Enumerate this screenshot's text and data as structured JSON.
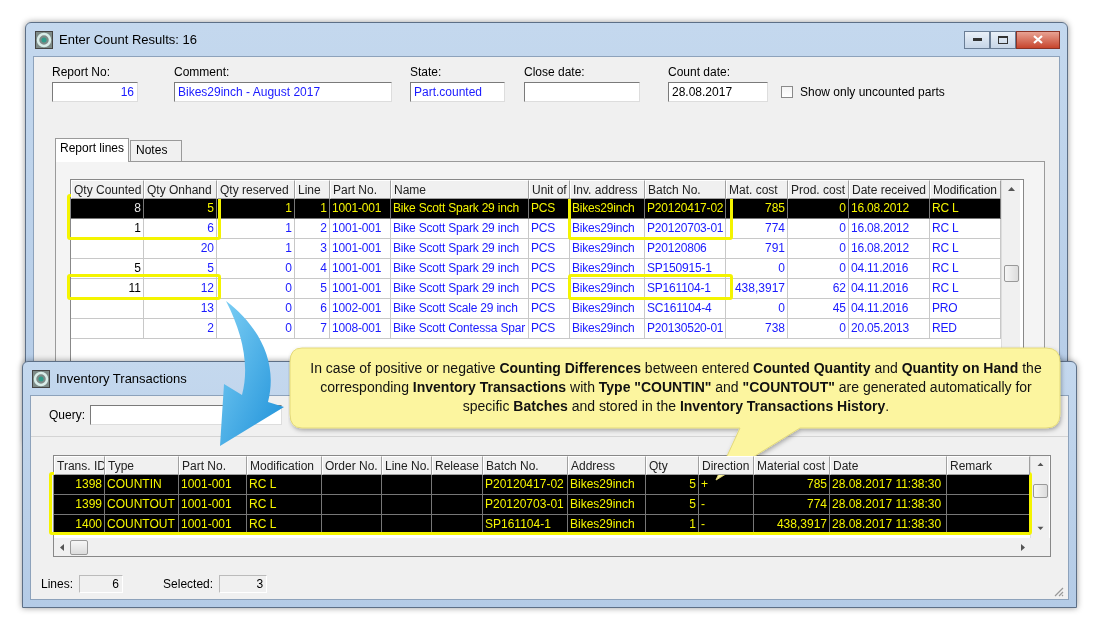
{
  "count_window": {
    "title": "Enter Count Results: 16",
    "fields": [
      {
        "label": "Report No:",
        "value": "16",
        "kind": "number"
      },
      {
        "label": "Comment:",
        "value": "Bikes29inch - August 2017",
        "kind": "text"
      },
      {
        "label": "State:",
        "value": "Part.counted",
        "kind": "text"
      },
      {
        "label": "Close date:",
        "kind": "date"
      },
      {
        "label": "Count date:",
        "value": "28.08.2017",
        "kind": "date"
      }
    ],
    "checkbox": {
      "label": "Show only uncounted parts",
      "checked": false
    },
    "tabs": [
      {
        "label": "Report lines",
        "selected": true
      },
      {
        "label": "Notes",
        "selected": false
      }
    ],
    "grid": {
      "columns": [
        {
          "label": "Qty Counted",
          "kind": "input"
        },
        {
          "label": "Qty Onhand",
          "kind": "number"
        },
        {
          "label": "Qty reserved",
          "kind": "number"
        },
        {
          "label": "Line",
          "kind": "number"
        },
        {
          "label": "Part No.",
          "kind": "text"
        },
        {
          "label": "Name",
          "kind": "text"
        },
        {
          "label": "Unit of",
          "kind": "text"
        },
        {
          "label": "Inv. address",
          "kind": "text"
        },
        {
          "label": "Batch No.",
          "kind": "text"
        },
        {
          "label": "Mat. cost",
          "kind": "number"
        },
        {
          "label": "Prod. cost",
          "kind": "number"
        },
        {
          "label": "Date received",
          "kind": "text"
        },
        {
          "label": "Modification",
          "kind": "text"
        }
      ],
      "rows": [
        {
          "selected": true,
          "cells": [
            "8",
            "5",
            "1",
            "1",
            "1001-001",
            "Bike Scott Spark 29 inch",
            "PCS",
            "Bikes29inch",
            "P20120417-02",
            "785",
            "0",
            "16.08.2012",
            "RC L"
          ]
        },
        {
          "selected": false,
          "cells": [
            "1",
            "6",
            "1",
            "2",
            "1001-001",
            "Bike Scott Spark 29 inch",
            "PCS",
            "Bikes29inch",
            "P20120703-01",
            "774",
            "0",
            "16.08.2012",
            "RC L"
          ]
        },
        {
          "selected": false,
          "cells": [
            null,
            "20",
            "1",
            "3",
            "1001-001",
            "Bike Scott Spark 29 inch",
            "PCS",
            "Bikes29inch",
            "P20120806",
            "791",
            "0",
            "16.08.2012",
            "RC L"
          ]
        },
        {
          "selected": false,
          "cells": [
            "5",
            "5",
            "0",
            "4",
            "1001-001",
            "Bike Scott Spark 29 inch",
            "PCS",
            "Bikes29inch",
            "SP150915-1",
            "0",
            "0",
            "04.11.2016",
            "RC L"
          ]
        },
        {
          "selected": false,
          "cells": [
            "11",
            "12",
            "0",
            "5",
            "1001-001",
            "Bike Scott Spark 29 inch",
            "PCS",
            "Bikes29inch",
            "SP161104-1",
            "438,3917",
            "62",
            "04.11.2016",
            "RC L"
          ]
        },
        {
          "selected": false,
          "cells": [
            null,
            "13",
            "0",
            "6",
            "1002-001",
            "Bike Scott Scale 29 inch",
            "PCS",
            "Bikes29inch",
            "SC161104-4",
            "0",
            "45",
            "04.11.2016",
            "PRO"
          ]
        },
        {
          "selected": false,
          "cells": [
            null,
            "2",
            "0",
            "7",
            "1008-001",
            "Bike Scott Contessa Spar",
            "PCS",
            "Bikes29inch",
            "P20130520-01",
            "738",
            "0",
            "20.05.2013",
            "RED"
          ]
        }
      ]
    }
  },
  "transactions_window": {
    "title": "Inventory Transactions",
    "query": {
      "label": "Query:"
    },
    "grid": {
      "columns": [
        {
          "label": "Trans. ID",
          "kind": "number"
        },
        {
          "label": "Type",
          "kind": "text"
        },
        {
          "label": "Part No.",
          "kind": "text"
        },
        {
          "label": "Modification",
          "kind": "text"
        },
        {
          "label": "Order No.",
          "kind": "text"
        },
        {
          "label": "Line No.",
          "kind": "text"
        },
        {
          "label": "Release",
          "kind": "text"
        },
        {
          "label": "Batch No.",
          "kind": "text"
        },
        {
          "label": "Address",
          "kind": "text"
        },
        {
          "label": "Qty",
          "kind": "number"
        },
        {
          "label": "Direction",
          "kind": "text"
        },
        {
          "label": "Material cost",
          "kind": "number"
        },
        {
          "label": "Date",
          "kind": "text"
        },
        {
          "label": "Remark",
          "kind": "text"
        }
      ],
      "rows": [
        {
          "selected": true,
          "cells": [
            "1398",
            "COUNTIN",
            "1001-001",
            "RC L",
            null,
            null,
            null,
            "P20120417-02",
            "Bikes29inch",
            "5",
            "+",
            "785",
            "28.08.2017 11:38:30",
            null
          ]
        },
        {
          "selected": true,
          "cells": [
            "1399",
            "COUNTOUT",
            "1001-001",
            "RC L",
            null,
            null,
            null,
            "P20120703-01",
            "Bikes29inch",
            "5",
            "-",
            "774",
            "28.08.2017 11:38:30",
            null
          ]
        },
        {
          "selected": true,
          "cells": [
            "1400",
            "COUNTOUT",
            "1001-001",
            "RC L",
            null,
            null,
            null,
            "SP161104-1",
            "Bikes29inch",
            "1",
            "-",
            "438,3917",
            "28.08.2017 11:38:30",
            null
          ]
        }
      ]
    },
    "status": [
      {
        "label": "Lines:",
        "value": "6"
      },
      {
        "label": "Selected:",
        "value": "3"
      }
    ]
  },
  "annotation": {
    "text": "In case of positive or negative **Counting Differences** between entered **Counted Quantity** and **Quantity on Hand** the corresponding **Inventory Transactions** with **Type \"COUNTIN\"** and **\"COUNTOUT\"** are generated automatically for specific **Batches** and stored in the **Inventory Transactions History**."
  }
}
